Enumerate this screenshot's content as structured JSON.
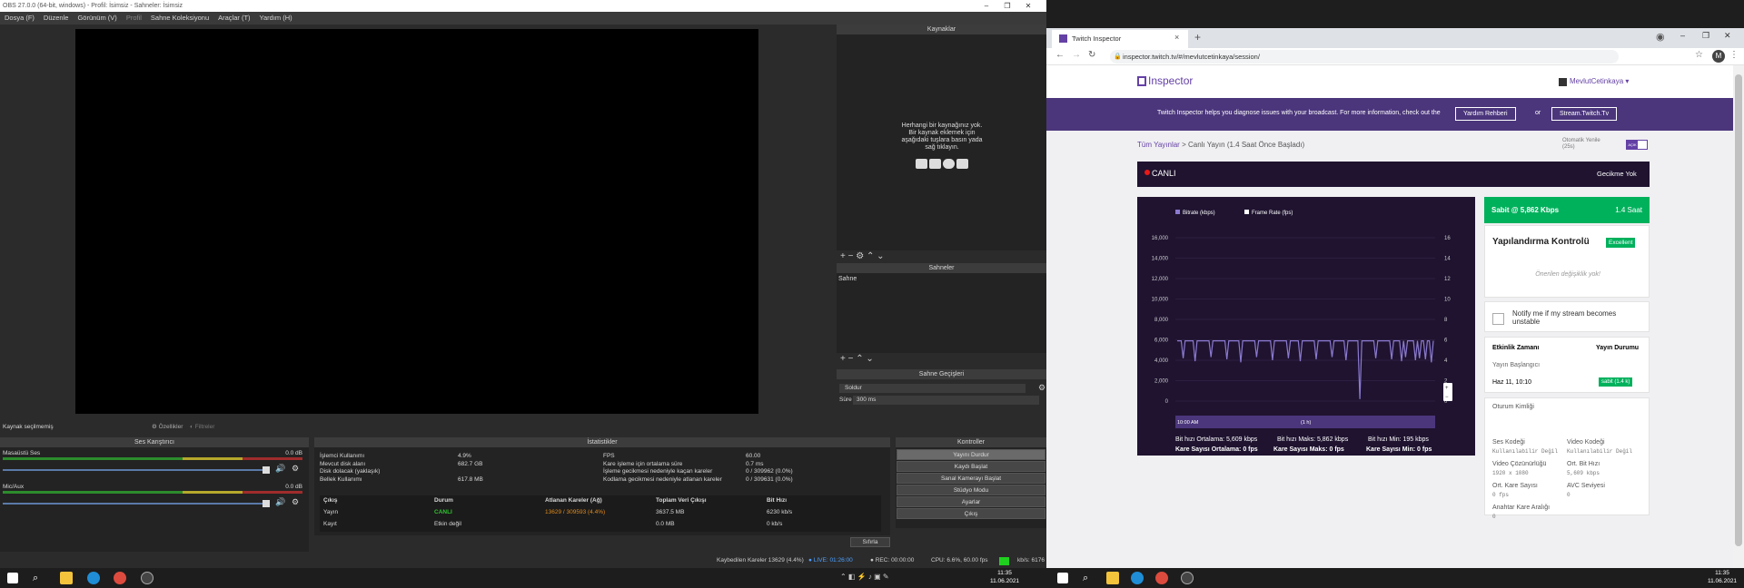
{
  "obs": {
    "title": "OBS 27.0.0 (64-bit, windows) - Profil: İsimsiz - Sahneler: İsimsiz",
    "menu": [
      "Dosya (F)",
      "Düzenle",
      "Görünüm (V)",
      "Profil",
      "Sahne Koleksiyonu",
      "Araçlar (T)",
      "Yardım (H)"
    ],
    "sources": {
      "title": "Kaynaklar",
      "empty_text": "Herhangi bir kaynağınız yok. Bir kaynak eklemek için aşağıdaki tuşlara basın yada sağ tıklayın."
    },
    "scenes": {
      "title": "Sahneler",
      "items": [
        "Sahne"
      ]
    },
    "transitions": {
      "title": "Sahne Geçişleri",
      "type": "Soldur",
      "duration_label": "Süre",
      "duration": "300 ms"
    },
    "no_source": "Kaynak seçilmemiş",
    "props_btn": "Özellikler",
    "filters_btn": "Filtreler",
    "mixer": {
      "title": "Ses Karıştırıcı",
      "channels": [
        {
          "name": "Masaüstü Ses",
          "db": "0.0 dB",
          "level": 0.82
        },
        {
          "name": "Mic/Aux",
          "db": "0.0 dB",
          "level": 0.82
        }
      ]
    },
    "stats": {
      "title": "İstatistikler",
      "left": [
        {
          "label": "İşlemci Kullanımı",
          "value": "4.9%"
        },
        {
          "label": "Mevcut disk alanı",
          "value": "682.7 GB"
        },
        {
          "label": "Disk dolacak (yaklaşık)",
          "value": ""
        },
        {
          "label": "Bellek Kullanımı",
          "value": "617.8 MB"
        }
      ],
      "right": [
        {
          "label": "FPS",
          "value": "60.00"
        },
        {
          "label": "Kare işleme için ortalama süre",
          "value": "0.7 ms"
        },
        {
          "label": "İşleme gecikmesi nedeniyle kaçan kareler",
          "value": "0 / 309962 (0.0%)"
        },
        {
          "label": "Kodlama gecikmesi nedeniyle atlanan kareler",
          "value": "0 / 309631 (0.0%)"
        }
      ],
      "table_headers": [
        "Çıkış",
        "Durum",
        "Atlanan Kareler (Ağ)",
        "Toplam Veri Çıkışı",
        "Bit Hızı"
      ],
      "rows": [
        {
          "output": "Yayın",
          "status": "CANLI",
          "dropped": "13629 / 309593 (4.4%)",
          "total": "3637.5 MB",
          "bitrate": "6230 kb/s"
        },
        {
          "output": "Kayıt",
          "status": "Etkin değil",
          "dropped": "",
          "total": "0.0 MB",
          "bitrate": "0 kb/s"
        }
      ],
      "reset_btn": "Sıfırla"
    },
    "controls": {
      "title": "Kontroller",
      "buttons": [
        "Yayını Durdur",
        "Kaydı Başlat",
        "Sanal Kamerayı Başlat",
        "Stüdyo Modu",
        "Ayarlar",
        "Çıkış"
      ]
    },
    "status": {
      "dropped": "Kaybedilen Kareler 13629 (4.4%)",
      "live": "LIVE: 01:26:00",
      "rec": "REC: 00:00:00",
      "cpu": "CPU: 6.6%, 60.00 fps",
      "kbps": "kb/s: 6176"
    },
    "clock": {
      "time": "11:35",
      "date": "11.06.2021"
    }
  },
  "chrome": {
    "tab_title": "Twitch Inspector",
    "url": "inspector.twitch.tv/#/mevlutcetinkaya/session/",
    "avatar_letter": "M",
    "clock": {
      "time": "11:35",
      "date": "11.06.2021"
    }
  },
  "inspector": {
    "logo": "Inspector",
    "user": "MevlutCetinkaya",
    "banner_text": "Twitch Inspector helps you diagnose issues with your broadcast. For more information, check out the",
    "banner_btn1": "Yardım Rehberi",
    "banner_or": "or",
    "banner_btn2": "Stream.Twitch.Tv",
    "breadcrumb_root": "Tüm Yayınlar",
    "breadcrumb_sep": ">",
    "breadcrumb_current": "Canlı Yayın (1.4 Saat Önce Başladı)",
    "auto_refresh_label": "Otomatik Yenile",
    "auto_refresh_sub": "(25s)",
    "toggle_label": "AÇIK",
    "live_label": "CANLI",
    "delay_label": "Gecikme Yok",
    "bitrate_card": {
      "label": "Sabit @ 5,862 Kbps",
      "hours": "1.4 Saat"
    },
    "config_card": {
      "title": "Yapılandırma Kontrolü",
      "badge": "Excellent",
      "note": "Önerilen değişiklik yok!"
    },
    "notify_text": "Notify me if my stream becomes unstable",
    "events": {
      "col1": "Etkinlik Zamanı",
      "col2": "Yayın Durumu",
      "row_label": "Yayın Başlangıcı",
      "time": "Haz 11, 10:10",
      "badge": "sabit (1.4 k)"
    },
    "session": {
      "title": "Oturum Kimliği",
      "fields": [
        {
          "label": "Ses Kodeği",
          "value": "Kullanılabilir Değil"
        },
        {
          "label": "Video Kodeği",
          "value": "Kullanılabilir Değil"
        },
        {
          "label": "Video Çözünürlüğü",
          "value": "1920 x 1080"
        },
        {
          "label": "Ort. Bit Hızı",
          "value": "5,609 kbps"
        },
        {
          "label": "Ort. Kare Sayısı",
          "value": "0 fps"
        },
        {
          "label": "AVC Seviyesi",
          "value": "0"
        },
        {
          "label": "Anahtar Kare Aralığı",
          "value": "0"
        }
      ]
    },
    "chart_summary": {
      "avg_bitrate": "Bit hızı Ortalama: 5,609 kbps",
      "max_bitrate": "Bit hızı Maks: 5,862 kbps",
      "min_bitrate": "Bit hızı Min: 195 kbps",
      "avg_fps": "Kare Sayısı Ortalama: 0 fps",
      "max_fps": "Kare Sayısı Maks: 0 fps",
      "min_fps": "Kare Sayısı Min: 0 fps"
    }
  },
  "chart_data": {
    "type": "line",
    "series": [
      {
        "name": "Bitrate (kbps)",
        "values": [
          5900,
          5900,
          5900,
          4200,
          5900,
          5900,
          5900,
          5900,
          5900,
          3900,
          5900,
          5900,
          5900,
          5900,
          5900,
          5900,
          5900,
          4300,
          5900,
          5900,
          5900,
          5900,
          5900,
          5900,
          5900,
          4100,
          5900,
          5900,
          5900,
          5900,
          5900,
          5900,
          3800,
          5900,
          5900,
          5900,
          5900,
          5900,
          5900,
          5900,
          4300,
          5900,
          5900,
          5900,
          5900,
          5900,
          5900,
          5900,
          4000,
          5900,
          5900,
          5900,
          5900,
          5900,
          5900,
          5900,
          4200,
          5900,
          5900,
          5900,
          5900,
          5900,
          3900,
          5900,
          5900,
          5900,
          5900,
          5900,
          5900,
          5900,
          4100,
          5900,
          5900,
          5900,
          5900,
          5900,
          5900,
          5900,
          4300,
          5900,
          5900,
          5900,
          5900,
          5900,
          5900,
          4000,
          5900,
          5900,
          5900,
          5900,
          5900,
          5900,
          200,
          5900,
          5900,
          5900,
          5900,
          5900,
          5900,
          5900,
          4200,
          5900,
          5900,
          5900,
          5900,
          5900,
          5900,
          5900,
          4100,
          5900,
          5900,
          5900,
          5900,
          3900,
          5900,
          4300,
          5900,
          5900,
          5900,
          5900,
          4000,
          5900,
          4200,
          5900,
          5900,
          4100,
          5900,
          5900,
          3800,
          5900
        ]
      },
      {
        "name": "Frame Rate (fps)",
        "values": []
      }
    ],
    "yleft_ticks": [
      "16,000",
      "14,000",
      "12,000",
      "10,000",
      "8,000",
      "6,000",
      "4,000",
      "2,000",
      "0"
    ],
    "yright_ticks": [
      "16",
      "14",
      "12",
      "10",
      "8",
      "6",
      "4",
      "2",
      "0"
    ],
    "ylim": [
      0,
      16000
    ],
    "x_start_label": "10:00 AM",
    "x_span_label": "(1 h)",
    "grid": true,
    "legend": "top-left",
    "colors": {
      "bitrate": "#8b7ad0",
      "fps": "#ffffff"
    }
  }
}
